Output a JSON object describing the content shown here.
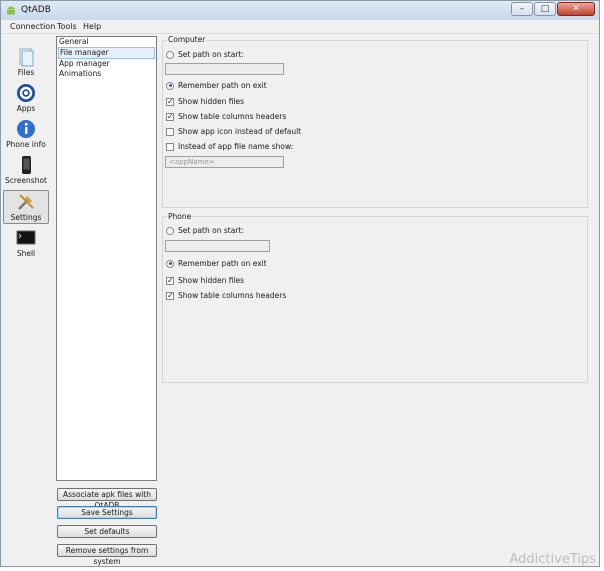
{
  "window": {
    "title": "QtADB",
    "min": "–",
    "max": "□",
    "close": "✕"
  },
  "menu": {
    "connection": "Connection",
    "tools": "Tools",
    "help": "Help"
  },
  "toolbar": [
    {
      "label": "Files",
      "icon": "files-icon"
    },
    {
      "label": "Apps",
      "icon": "apps-icon"
    },
    {
      "label": "Phone info",
      "icon": "phone-info-icon"
    },
    {
      "label": "Screenshot",
      "icon": "screenshot-icon"
    },
    {
      "label": "Settings",
      "icon": "settings-icon"
    },
    {
      "label": "Shell",
      "icon": "shell-icon"
    }
  ],
  "nav": [
    "General",
    "File manager",
    "App manager",
    "Animations"
  ],
  "buttons": {
    "associate": "Associate apk files with QtADB",
    "save": "Save Settings",
    "defaults": "Set defaults",
    "remove": "Remove settings from system"
  },
  "computer": {
    "title": "Computer",
    "set_path": "Set path on start:",
    "remember": "Remember path on exit",
    "hidden": "Show hidden files",
    "columns": "Show table columns headers",
    "appicon": "Show app icon instead of default",
    "instead": "Instead of app file name show:",
    "appname_placeholder": "<appName>"
  },
  "phone": {
    "title": "Phone",
    "set_path": "Set path on start:",
    "remember": "Remember path on exit",
    "hidden": "Show hidden files",
    "columns": "Show table columns headers"
  },
  "watermark": "AddictiveTips"
}
